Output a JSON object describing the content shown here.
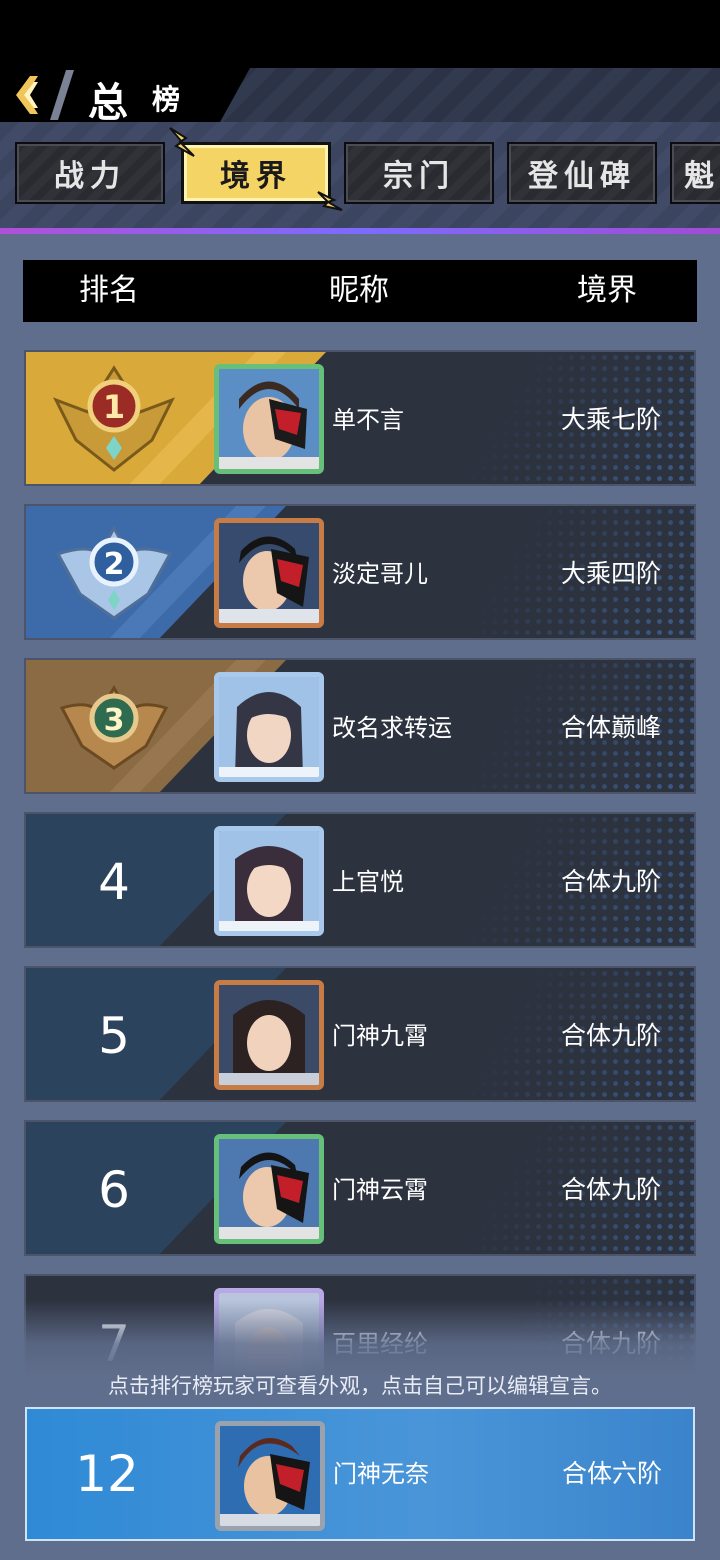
{
  "header": {
    "title": "总",
    "subtitle": "榜"
  },
  "tabs": [
    {
      "label": "战力",
      "active": false
    },
    {
      "label": "境界",
      "active": true
    },
    {
      "label": "宗门",
      "active": false
    },
    {
      "label": "登仙碑",
      "active": false
    },
    {
      "label": "魁",
      "active": false
    }
  ],
  "table": {
    "columns": [
      "排名",
      "昵称",
      "境界"
    ],
    "rows": [
      {
        "rank": "1",
        "name": "单不言",
        "realm": "大乘七阶"
      },
      {
        "rank": "2",
        "name": "淡定哥儿",
        "realm": "大乘四阶"
      },
      {
        "rank": "3",
        "name": "改名求转运",
        "realm": "合体巅峰"
      },
      {
        "rank": "4",
        "name": "上官悦",
        "realm": "合体九阶"
      },
      {
        "rank": "5",
        "name": "门神九霄",
        "realm": "合体九阶"
      },
      {
        "rank": "6",
        "name": "门神云霄",
        "realm": "合体九阶"
      },
      {
        "rank": "7",
        "name": "百里经纶",
        "realm": "合体九阶"
      }
    ]
  },
  "hint": "点击排行榜玩家可查看外观，点击自己可以编辑宣言。",
  "my_row": {
    "rank": "12",
    "name": "门神无奈",
    "realm": "合体六阶"
  },
  "colors": {
    "active_tab": "#f5d466",
    "gold_stripe": "#d9a93a",
    "silver_stripe": "#3d6aa8",
    "bronze_stripe": "#8a6b44",
    "my_row": "#3b8ed6"
  }
}
